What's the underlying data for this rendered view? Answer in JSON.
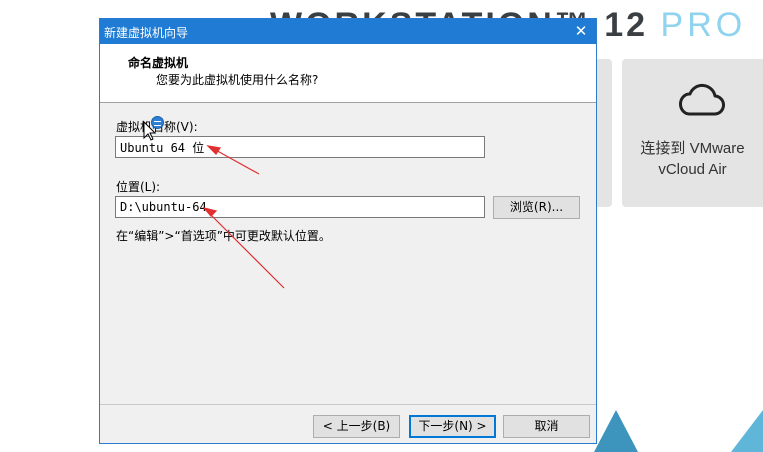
{
  "background": {
    "title_main": "WORKSTATION™ 12",
    "title_suffix": "PRO",
    "tile": {
      "icon": "cloud-icon",
      "label": "连接到 VMware\nvCloud Air"
    }
  },
  "dialog": {
    "title": "新建虚拟机向导",
    "close_label": "✕",
    "header_title": "命名虚拟机",
    "header_subtitle": "您要为此虚拟机使用什么名称?",
    "name_label": "虚拟机名称(V):",
    "name_value": "Ubuntu 64 位",
    "location_label": "位置(L):",
    "location_value": "D:\\ubuntu-64",
    "browse_label": "浏览(R)...",
    "hint": "在“编辑”>“首选项”中可更改默认位置。",
    "back_label": "< 上一步(B)",
    "next_label": "下一步(N) >",
    "cancel_label": "取消"
  },
  "colors": {
    "titlebar": "#1f7bd4",
    "annotation_arrow": "#e03030",
    "accent_light": "#8fd3ee"
  }
}
